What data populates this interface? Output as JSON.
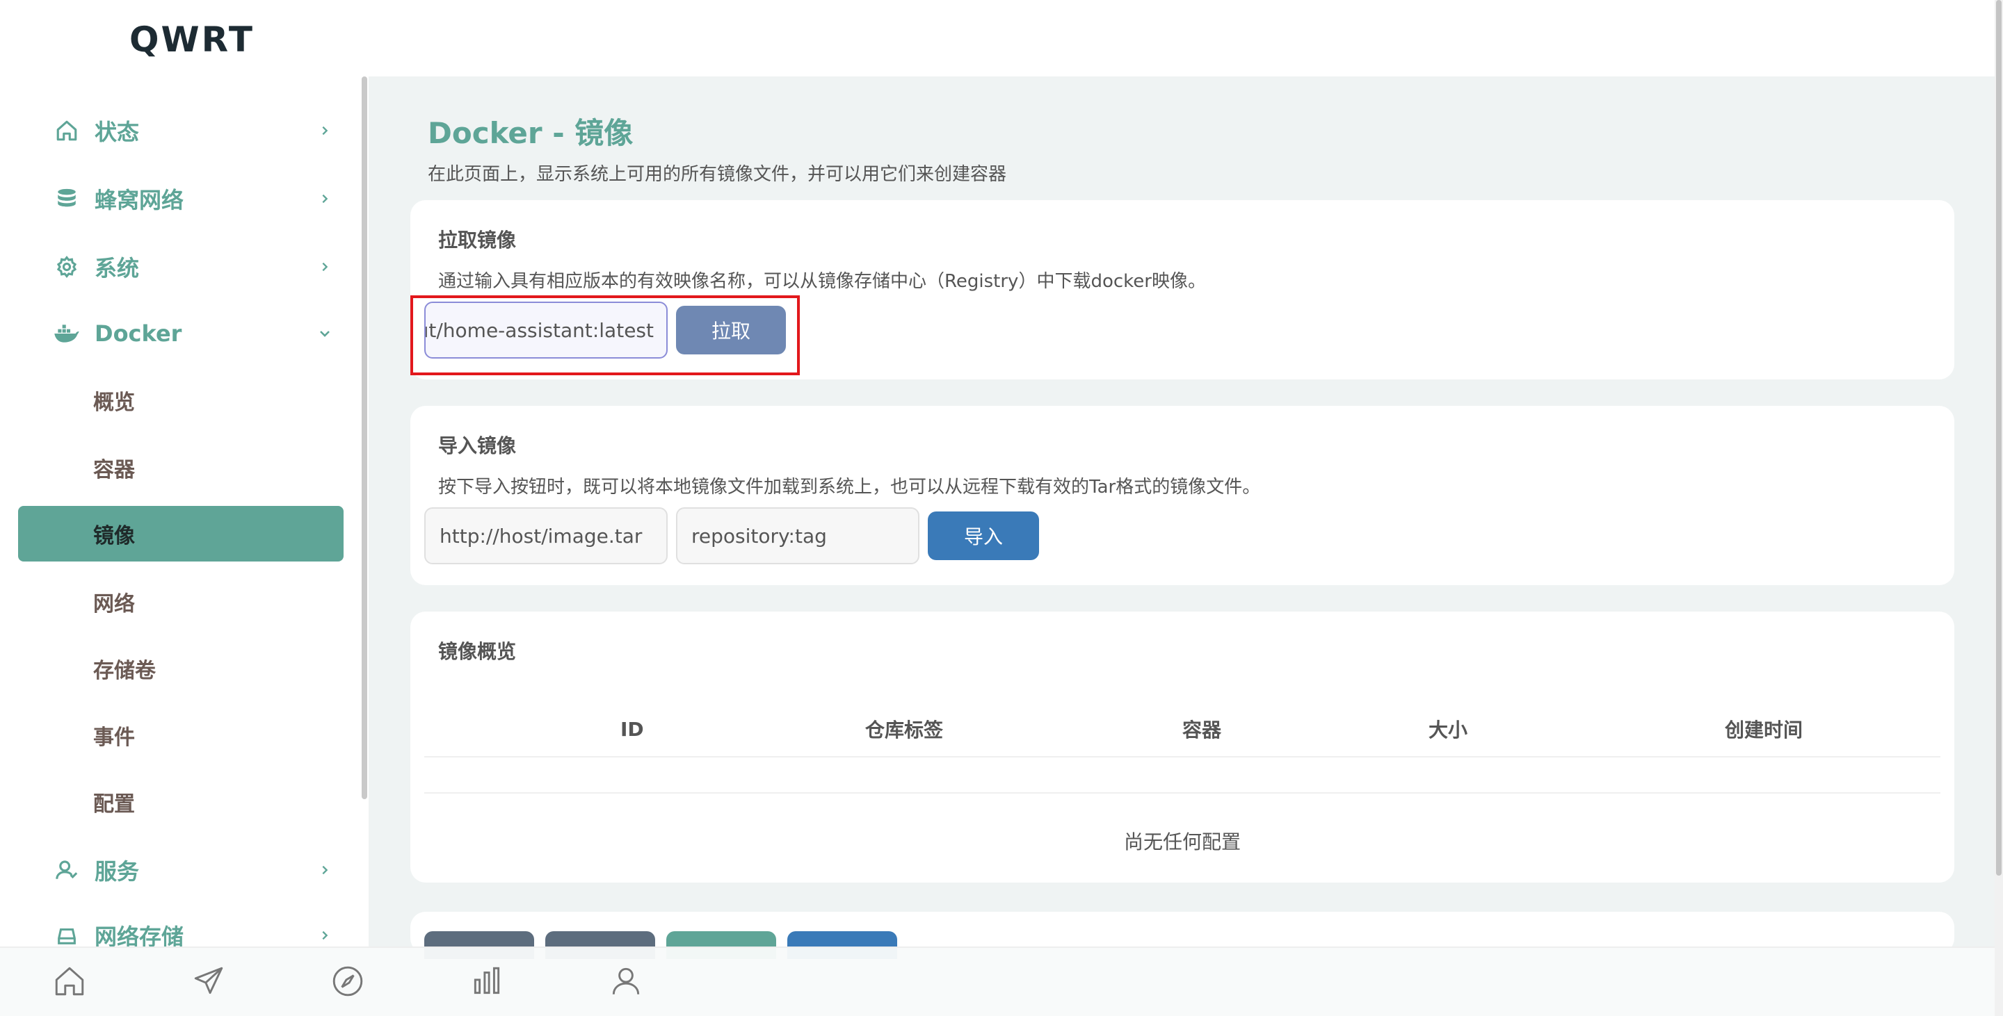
{
  "brand": "QWRT",
  "sidebar": {
    "items": [
      {
        "label": "状态",
        "icon": "home-icon"
      },
      {
        "label": "蜂窝网络",
        "icon": "database-icon"
      },
      {
        "label": "系统",
        "icon": "gear-icon"
      },
      {
        "label": "Docker",
        "icon": "docker-icon"
      },
      {
        "label": "服务",
        "icon": "user-icon"
      },
      {
        "label": "网络存储",
        "icon": "storage-icon"
      }
    ],
    "docker_sub": [
      {
        "label": "概览"
      },
      {
        "label": "容器"
      },
      {
        "label": "镜像"
      },
      {
        "label": "网络"
      },
      {
        "label": "存储卷"
      },
      {
        "label": "事件"
      },
      {
        "label": "配置"
      }
    ],
    "active_sub": "镜像"
  },
  "main": {
    "title": "Docker - 镜像",
    "description": "在此页面上，显示系统上可用的所有镜像文件，并可以用它们来创建容器",
    "pull": {
      "title": "拉取镜像",
      "description": "通过输入具有相应版本的有效映像名称，可以从镜像存储中心（Registry）中下载docker映像。",
      "input_value": "ıt/home-assistant:latest",
      "button": "拉取"
    },
    "import": {
      "title": "导入镜像",
      "description": "按下导入按钮时，既可以将本地镜像文件加载到系统上，也可以从远程下载有效的Tar格式的镜像文件。",
      "url_placeholder": "http://host/image.tar",
      "tag_placeholder": "repository:tag",
      "button": "导入"
    },
    "overview": {
      "title": "镜像概览",
      "columns": [
        "ID",
        "仓库标签",
        "容器",
        "大小",
        "创建时间"
      ],
      "empty": "尚无任何配置"
    }
  },
  "colors": {
    "accent": "#5ea597",
    "pull_button": "#6f88b3",
    "import_button": "#3a7ab8",
    "highlight_box": "#e2181c"
  },
  "bottombar": {
    "icons": [
      "home-icon",
      "send-icon",
      "compass-icon",
      "bar-chart-icon",
      "user-icon"
    ]
  }
}
